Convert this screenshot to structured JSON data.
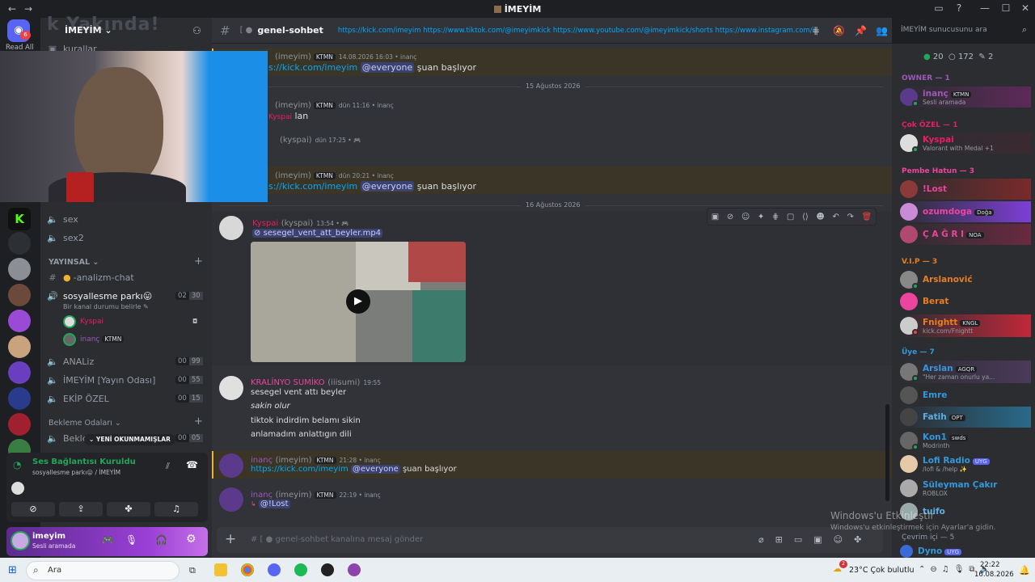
{
  "window": {
    "title": "İMEYİM",
    "back": "←",
    "forward": "→",
    "minimize": "—",
    "maximize": "☐",
    "close": "✕"
  },
  "server": {
    "name": "İMEYİM",
    "overlay_text": "k Yakında!",
    "read_all": "Read All",
    "server_badge": "6"
  },
  "sidebar": {
    "top_channel": "kurallar",
    "channels_voice": [
      "sex",
      "sex2"
    ],
    "category_yayinsal": "YAYINSAL",
    "analizm": "-analizm-chat",
    "voice_active": {
      "name": "sosyallesme parkı😛",
      "status": "Bir kanal durumu belirle",
      "count_a": "02",
      "count_b": "30"
    },
    "voice_users": [
      {
        "name": "Kyspai"
      },
      {
        "name": "inanç",
        "tag": "KTMN"
      }
    ],
    "channels_more": [
      {
        "name": "ANALiz",
        "a": "00",
        "b": "99"
      },
      {
        "name": "İMEYİM [Yayın Odası]",
        "a": "00",
        "b": "55"
      },
      {
        "name": "EKİP ÖZEL",
        "a": "00",
        "b": "15"
      }
    ],
    "category_bekleme": "Bekleme Odaları",
    "bekle_channel": "Bekle",
    "bekle_a": "00",
    "bekle_b": "05",
    "unread_pill": "YENİ OKUNMAMIŞLAR"
  },
  "voice_panel": {
    "title": "Ses Bağlantısı Kuruldu",
    "subtitle": "sosyallesme parkı😛 / İMEYİM"
  },
  "user_panel": {
    "name": "imeyim",
    "status": "Sesli aramada"
  },
  "chat": {
    "channel_name": "genel-sohbet",
    "topic": "https://kick.com/imeyim https://www.tiktok.com/@imeyimkick https://www.youtube.com/@imeyimkick/shorts https://www.instagram.com/ime...",
    "search_placeholder": "İMEYİM sunucusunu ara",
    "messages": [
      {
        "user": "(imeyim)",
        "tag": "KTMN",
        "ts": "14.08.2026 16:03 • inanç",
        "link": "s://kick.com/imeyim",
        "ping": "@everyone",
        "text": "şuan başlıyor"
      },
      {
        "user": "(imeyim)",
        "tag": "KTMN",
        "ts": "dün 11:16 • inanç",
        "name2": "Kyspai",
        "text": "lan"
      },
      {
        "user": "(kyspai)",
        "ts": "dün 17:25 • 🎮"
      },
      {
        "user": "(imeyim)",
        "tag": "KTMN",
        "ts": "dün 20:21 • inanç",
        "link": "s://kick.com/imeyim",
        "ping": "@everyone",
        "text": "şuan başlıyor"
      },
      {
        "user": "Kyspai",
        "handle": "(kyspai)",
        "ts": "13:54 • 🎮",
        "attachment": "sesegel_vent_att_beyler.mp4"
      },
      {
        "user": "KRALİNYO SUMİKO",
        "handle": "(iiisumi)",
        "ts": "19:55",
        "lines": [
          "sesegel vent attı beyler",
          "sakin olur",
          "tiktok indirdim belamı sikin",
          "anlamadım anlattıgın dili"
        ]
      },
      {
        "user": "inanç",
        "handle": "(imeyim)",
        "tag": "KTMN",
        "ts": "21:28 • inanç",
        "link": "https://kick.com/imeyim",
        "ping": "@everyone",
        "text": "şuan başlıyor"
      },
      {
        "user": "inanç",
        "handle": "(imeyim)",
        "tag": "KTMN",
        "ts": "22:19 • inanç",
        "ping": "@!Lost"
      }
    ],
    "dates": [
      "15 Ağustos 2026",
      "16 Ağustos 2026"
    ],
    "composer_placeholder": "genel-sohbet kanalına mesaj gönder"
  },
  "members": {
    "online": "20",
    "idle": "172",
    "boosters": "2",
    "groups": [
      {
        "title": "OWNER — 1",
        "color": "#9b59b6"
      },
      {
        "title": "Çok ÖZEL — 1",
        "color": "#e91e63"
      },
      {
        "title": "Pembe Hatun — 3",
        "color": "#eb459e"
      },
      {
        "title": "V.I.P — 3",
        "color": "#e67e22"
      },
      {
        "title": "Üye — 7",
        "color": "#3498db"
      }
    ],
    "list": [
      {
        "name": "inanç",
        "badge": "KTMN",
        "sub": "Sesli aramada",
        "color": "#9b59b6"
      },
      {
        "name": "Kyspai",
        "sub": "Valorant with Medal +1",
        "color": "#e91e63"
      },
      {
        "name": "!Lost",
        "color": "#eb459e"
      },
      {
        "name": "ozumdoga",
        "badge": "Doğa",
        "color": "#eb459e"
      },
      {
        "name": "Ç A Ğ R I",
        "badge": "NOA",
        "color": "#eb459e"
      },
      {
        "name": "Arslanović",
        "color": "#e67e22"
      },
      {
        "name": "Berat",
        "color": "#e67e22"
      },
      {
        "name": "Fnightt",
        "badge": "KNGL",
        "sub": "kick.com/Fnightt",
        "color": "#e67e22"
      },
      {
        "name": "Arslan",
        "badge": "AGQR",
        "sub": "\"Her zaman onurlu ya...",
        "color": "#3498db"
      },
      {
        "name": "Emre",
        "color": "#3498db"
      },
      {
        "name": "Fatih",
        "badge": "OPT",
        "color": "#3498db"
      },
      {
        "name": "Kon1",
        "badge": "swds",
        "sub": "Modrinth",
        "color": "#3498db"
      },
      {
        "name": "Lofi Radio",
        "badge": "UYG",
        "sub": "/lofi & /help ✨",
        "color": "#3498db"
      },
      {
        "name": "Süleyman Çakır",
        "sub": "ROBLOX",
        "color": "#3498db"
      },
      {
        "name": "tuifo",
        "color": "#3498db"
      },
      {
        "name": "Dyno",
        "badge": "UYG",
        "color": "#3498db"
      }
    ],
    "offline_header": "Çevrim içi — 5"
  },
  "watermark": {
    "line1": "Windows'u Etkinleştir",
    "line2": "Windows'u etkinleştirmek için Ayarlar'a gidin."
  },
  "taskbar": {
    "search": "Ara",
    "weather": "23°C  Çok bulutlu",
    "time": "22:22",
    "date": "16.08.2026",
    "weather_badge": "2"
  }
}
